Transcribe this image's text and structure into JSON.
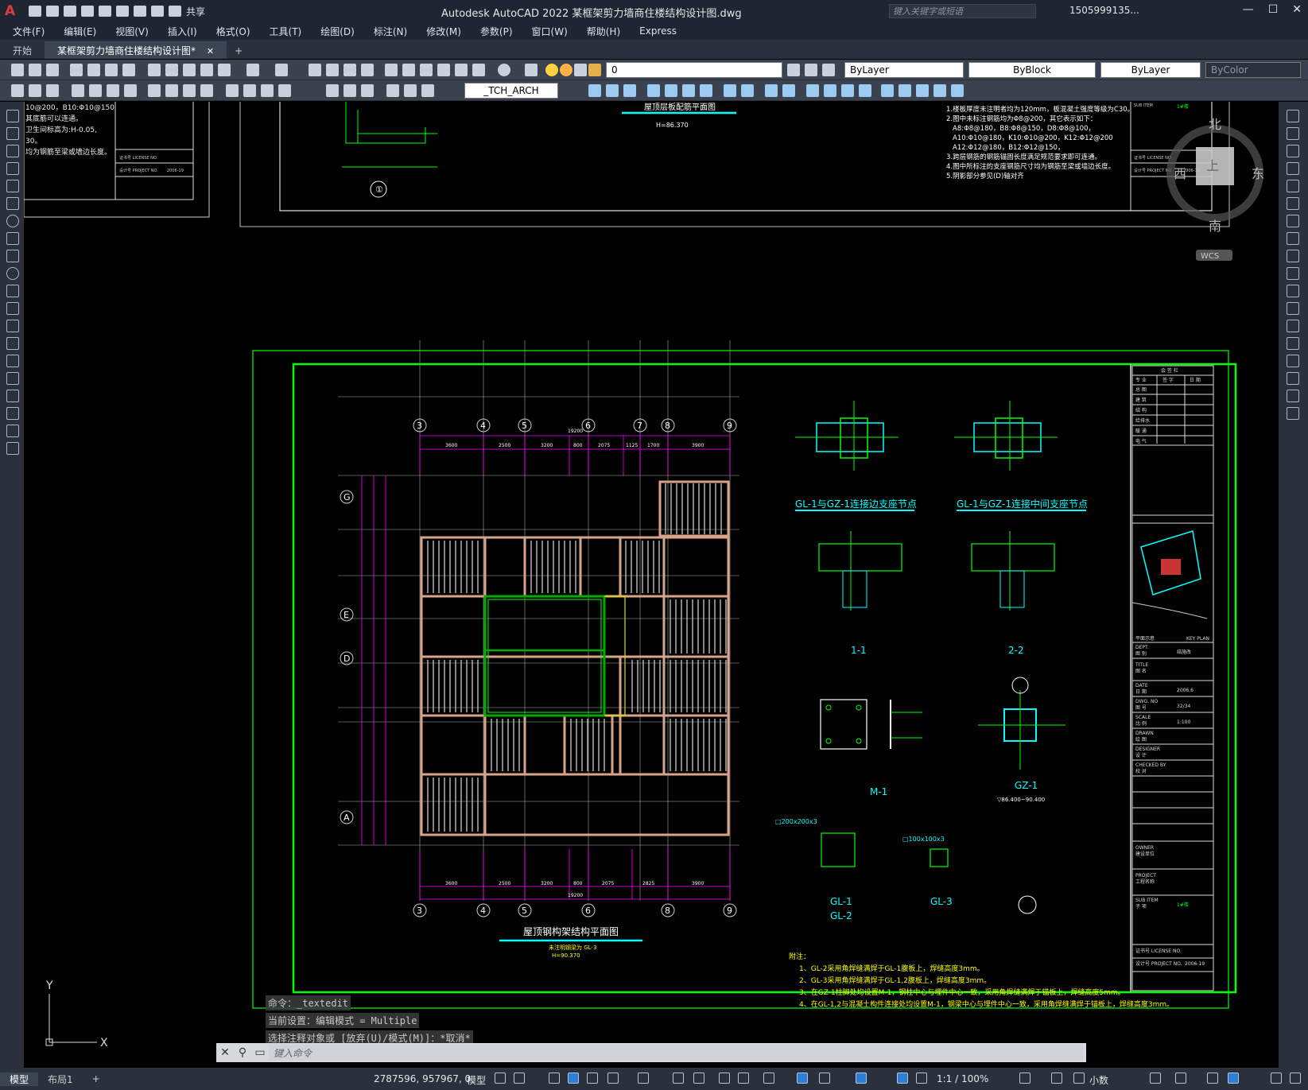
{
  "app": {
    "title": "Autodesk AutoCAD 2022   某框架剪力墙商住楼结构设计图.dwg",
    "logo": "A",
    "share": "共享",
    "search_placeholder": "键入关键字或短语",
    "user": "1505999135...",
    "window_controls": [
      "—",
      "☐",
      "✕"
    ]
  },
  "menu": [
    "文件(F)",
    "编辑(E)",
    "视图(V)",
    "插入(I)",
    "格式(O)",
    "工具(T)",
    "绘图(D)",
    "标注(N)",
    "修改(M)",
    "参数(P)",
    "窗口(W)",
    "帮助(H)",
    "Express"
  ],
  "tabs": [
    {
      "label": "开始",
      "active": false
    },
    {
      "label": "某框架剪力墙商住楼结构设计图*",
      "active": true
    }
  ],
  "tab_close": "✕",
  "tab_add": "+",
  "toolbar": {
    "layer": "0",
    "color": "ByLayer",
    "linetype": "ByBlock",
    "lineweight": "ByLayer",
    "plotstyle": "ByColor",
    "textstyle": "_TCH_ARCH"
  },
  "viewcube": {
    "north": "北",
    "south": "南",
    "east": "东",
    "west": "西",
    "top": "上",
    "wcs": "WCS"
  },
  "drawing": {
    "plan_title": "屋顶钢构架结构平面图",
    "plan_sub1": "未注明钢梁为 GL-3",
    "plan_sub2": "H=90.370",
    "top_title": "屋顶层板配筋平面图",
    "top_sub": "H=86.370",
    "detail1_title": "GL-1与GZ-1连接边支座节点",
    "detail2_title": "GL-1与GZ-1连接中间支座节点",
    "sec1": "1-1",
    "sec2": "2-2",
    "m1": "M-1",
    "gz1": "GZ-1",
    "gz1_range": "▽86.400~90.400",
    "gl12": "GL-1",
    "gl12b": "GL-2",
    "gl3": "GL-3",
    "size1": "□200x200x3",
    "size2": "□100x100x3",
    "grid_top": [
      "3",
      "4",
      "5",
      "6",
      "7",
      "8",
      "9"
    ],
    "grid_left": [
      "G",
      "E",
      "D",
      "A"
    ],
    "total_dim": "19200",
    "top_dims": [
      "3600",
      "2500",
      "3200",
      "800",
      "2075",
      "1125",
      "1700",
      "3900"
    ],
    "bottom_dims": [
      "3600",
      "2500",
      "3200",
      "800",
      "2075",
      "2825",
      "3900"
    ],
    "notes_title": "附注：",
    "notes": [
      "1、GL-2采用角焊缝满焊于GL-1腹板上，焊缝高度3mm。",
      "2、GL-3采用角焊缝满焊于GL-1,2腹板上，焊缝高度3mm。",
      "3、在GZ-1柱脚处均设置M-1，钢柱中心与埋件中心一致，采用角焊缝满焊于锚板上，焊缝高度5mm。",
      "4、在GL-1,2与混凝土构件连接处均设置M-1，钢梁中心与埋件中心一致，采用角焊缝满焊于锚板上，焊缝高度3mm。"
    ],
    "top_notes": [
      "1.楼板厚度未注明者均为120mm，板混凝土强度等级为C30。",
      "2.图中未标注钢筋均为Φ8@200，其它表示如下：",
      "A8:Φ8@180，B8:Φ8@150，D8:Φ8@100，",
      "A10:Φ10@180，K10:Φ10@200，K12:Φ12@200",
      "A12:Φ12@180，B12:Φ12@150，",
      "3.跨层钢筋的钢筋锚固长度满足规范要求即可连通。",
      "4.图中所标注的支座钢筋尺寸均为钢筋至梁或墙边长度。",
      "5.阴影部分参见(D)轴对齐"
    ],
    "left_notes": [
      "10@200，B10:Φ10@150",
      "其底筋可以连通。",
      "卫生间标高为:H-0.05,",
      "30。",
      "均为钢筋至梁或墙边长度。"
    ],
    "tb": {
      "sign_header": "会 签 栏",
      "cols": [
        "专 业",
        "签 字",
        "日 期"
      ],
      "rows": [
        "总 图",
        "建 筑",
        "结 构",
        "给排水",
        "暖 通",
        "电 气"
      ],
      "key_plan": "KEY PLAN",
      "key_plan_cn": "平面示意",
      "dept": "DEPT.",
      "dept_cn": "图 别",
      "dept_val": "结施改",
      "title_lbl": "TITLE",
      "title_cn": "图 名",
      "date_lbl": "DATE",
      "date_cn": "日 期",
      "date_val": "2006.6",
      "dwg_lbl": "DWG. NO",
      "dwg_cn": "图 号",
      "dwg_val": "32/34",
      "scale_lbl": "SCALE",
      "scale_cn": "比 例",
      "scale_val": "1:100",
      "drawn": "DRAWN",
      "drawn_cn": "绘 图",
      "designer": "DESIGNER",
      "designer_cn": "设 计",
      "checked": "CHECKED BY",
      "checked_cn": "校 对",
      "owner": "OWNER",
      "owner_cn": "建设单位",
      "project": "PROJECT",
      "project_cn": "工程名称",
      "sub_item": "SUB ITEM",
      "sub_item_cn": "子 项",
      "sub_item_val": "1#楼",
      "license": "证书号 LICENSE NO.",
      "project_no": "设计号 PROJECT NO.",
      "project_no_val": "2006-19"
    }
  },
  "command": {
    "history": [
      "命令：_textedit",
      "当前设置：编辑模式 = Multiple",
      "选择注释对象或 [放弃(U)/模式(M)]：*取消*"
    ],
    "placeholder": "键入命令",
    "close": "✕"
  },
  "status": {
    "tabs": [
      {
        "label": "模型",
        "active": true
      },
      {
        "label": "布局1",
        "active": false
      }
    ],
    "add": "+",
    "coords": "2787596, 957967, 0",
    "model": "模型",
    "scale": "1:1 / 100%",
    "units": "小数"
  },
  "colors": {
    "frame_green": "#00ff00",
    "cyan": "#00ffff",
    "magenta": "#ff00ff",
    "beam": "#d9a58a",
    "yellow": "#ffff00",
    "white": "#ffffff"
  }
}
